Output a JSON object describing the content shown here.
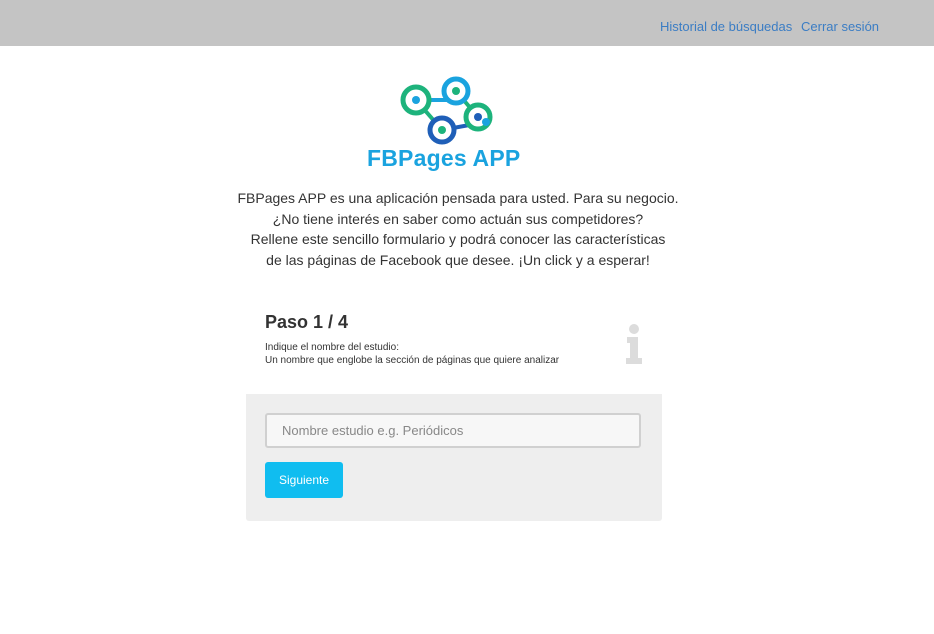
{
  "nav": {
    "history_label": "Historial de búsquedas",
    "logout_label": "Cerrar sesión"
  },
  "brand": {
    "name": "FBPages APP",
    "colors": {
      "blue": "#1aa3df",
      "green": "#1db37c",
      "dark_blue": "#1f5fb8"
    }
  },
  "intro": {
    "lines": [
      "FBPages APP es una aplicación pensada para usted. Para su negocio.",
      "¿No tiene interés en saber como actuán sus competidores?",
      "Rellene este sencillo formulario y podrá conocer las características",
      "de las páginas de Facebook que desee. ¡Un click y a esperar!"
    ]
  },
  "step": {
    "title": "Paso 1 / 4",
    "desc_line1": "Indique el nombre del estudio:",
    "desc_line2": "Un nombre que englobe la sección de páginas que quiere analizar",
    "icon": "info-icon"
  },
  "form": {
    "input_value": "",
    "input_placeholder": "Nombre estudio e.g. Periódicos",
    "submit_label": "Siguiente",
    "accent_color": "#10bdf0"
  }
}
